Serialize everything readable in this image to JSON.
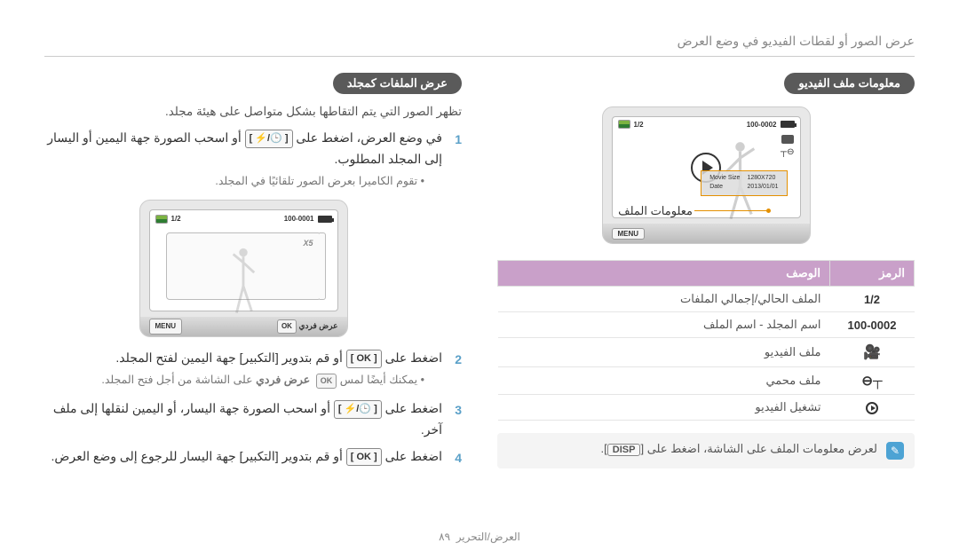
{
  "header": {
    "title": "عرض الصور أو لقطات الفيديو في وضع العرض"
  },
  "right": {
    "heading": "معلومات ملف الفيديو",
    "screen": {
      "counter": "1/2",
      "file": "100-0002",
      "info_label1": "Movie Size",
      "info_val1": "1280X720",
      "info_label2": "Date",
      "info_val2": "2013/01/01",
      "menu": "MENU"
    },
    "callout": "معلومات الملف",
    "table": {
      "h_icon": "الرمز",
      "h_desc": "الوصف",
      "rows": [
        {
          "sym": "1/2",
          "desc": "الملف الحالي/إجمالي الملفات"
        },
        {
          "sym": "100-0002",
          "desc": "اسم المجلد - اسم الملف"
        },
        {
          "sym": "cam",
          "desc": "ملف الفيديو"
        },
        {
          "sym": "lock",
          "desc": "ملف محمي"
        },
        {
          "sym": "play",
          "desc": "تشغيل الفيديو"
        }
      ]
    },
    "note": {
      "text_before": "لعرض معلومات الملف على الشاشة، اضغط على ",
      "btn": "DISP",
      "text_after": "."
    }
  },
  "left": {
    "heading": "عرض الملفات كمجلد",
    "intro": "تظهر الصور التي يتم التقاطها بشكل متواصل على هيئة مجلد.",
    "screen": {
      "counter": "1/2",
      "file": "100-0001",
      "x5": "X5",
      "menu": "MENU",
      "ok": "OK",
      "ok_label": "عرض فردي"
    },
    "steps": [
      {
        "text_a": "في وضع العرض، اضغط على ",
        "key1": "[ ⚡/🕒 ]",
        "text_b": " أو اسحب الصورة جهة اليمين أو اليسار إلى المجلد المطلوب.",
        "note": "تقوم الكاميرا بعرض الصور تلقائيًا في المجلد."
      },
      {
        "text_a": "اضغط على ",
        "key1": "[ OK ]",
        "text_b": " أو قم بتدوير [التكبير] جهة اليمين لفتح المجلد.",
        "note_before": "يمكنك أيضًا لمس ",
        "note_ok": "OK",
        "note_bold": " عرض فردي",
        "note_after": " على الشاشة من أجل فتح المجلد."
      },
      {
        "text_a": "اضغط على ",
        "key1": "[ ⚡/🕒 ]",
        "text_b": " أو اسحب الصورة جهة اليسار، أو اليمين لنقلها إلى ملف آخر."
      },
      {
        "text_a": "اضغط على ",
        "key1": "[ OK ]",
        "text_b": " أو قم بتدوير [التكبير] جهة اليسار للرجوع إلى وضع العرض."
      }
    ]
  },
  "footer": {
    "section": "العرض/التحرير",
    "page": "٨٩"
  }
}
